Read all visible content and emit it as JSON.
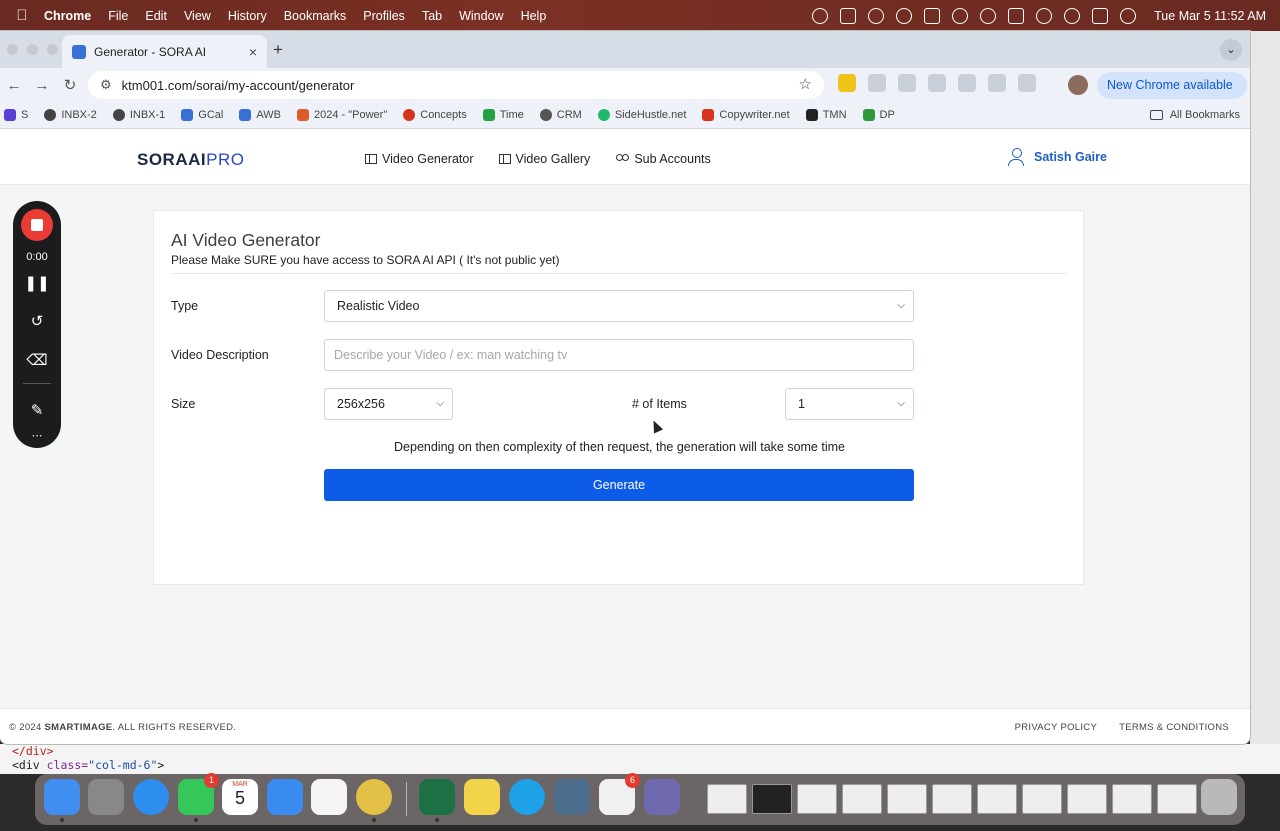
{
  "menubar": {
    "app_name": "Chrome",
    "menus": [
      "File",
      "Edit",
      "View",
      "History",
      "Bookmarks",
      "Profiles",
      "Tab",
      "Window",
      "Help"
    ],
    "clock": "Tue Mar 5  11:52 AM"
  },
  "browser": {
    "tab_title": "Generator - SORA AI",
    "url": "ktm001.com/sorai/my-account/generator",
    "update_label": "New Chrome available",
    "bookmarks": [
      {
        "label": "S",
        "color": "#5a3fd6"
      },
      {
        "label": "INBX-2",
        "color": "#444444"
      },
      {
        "label": "INBX-1",
        "color": "#444444"
      },
      {
        "label": "GCal",
        "color": "#3b6fd8"
      },
      {
        "label": "AWB",
        "color": "#3b6fd8"
      },
      {
        "label": "2024 - \"Power\"",
        "color": "#e05a2a"
      },
      {
        "label": "Concepts",
        "color": "#d6341c"
      },
      {
        "label": "Time",
        "color": "#25a244"
      },
      {
        "label": "CRM",
        "color": "#555555"
      },
      {
        "label": "SideHustle.net",
        "color": "#22b86a"
      },
      {
        "label": "Copywriter.net",
        "color": "#d6341c"
      },
      {
        "label": "TMN",
        "color": "#222222"
      },
      {
        "label": "DP",
        "color": "#2c9a3a"
      }
    ],
    "all_bookmarks": "All Bookmarks"
  },
  "site": {
    "logo_main": "SORAAI",
    "logo_suffix": "PRO",
    "nav": {
      "video_generator": "Video Generator",
      "video_gallery": "Video Gallery",
      "sub_accounts": "Sub Accounts"
    },
    "user_name": "Satish Gaire",
    "footer": {
      "copyright_prefix": "© 2024 ",
      "copyright_brand": "SMARTIMAGE",
      "copyright_suffix": ". ALL RIGHTS RESERVED.",
      "privacy": "PRIVACY POLICY",
      "terms": "TERMS & CONDITIONS"
    }
  },
  "generator": {
    "title": "AI Video Generator",
    "subtitle": "Please Make SURE you have access to SORA AI API ( It's not public yet)",
    "type_label": "Type",
    "type_value": "Realistic Video",
    "description_label": "Video Description",
    "description_placeholder": "Describe your Video / ex: man watching tv",
    "size_label": "Size",
    "size_value": "256x256",
    "items_label": "# of Items",
    "items_value": "1",
    "hint": "Depending on then complexity of then request, the generation will take some time",
    "generate_label": "Generate"
  },
  "recorder": {
    "time": "0:00"
  },
  "devtools_snippet": {
    "line1": "</div>",
    "line2_tag": "<div ",
    "line2_attr": "class=",
    "line2_val": "\"col-md-6\"",
    "line2_end": ">"
  },
  "dock": {
    "messages_badge": "1",
    "calendar_month": "MAR",
    "calendar_day": "5",
    "store_badge": "6"
  },
  "colors": {
    "accent": "#0d5ce8",
    "user_link": "#1f5ec5",
    "logo_pro": "#2a46c8"
  }
}
